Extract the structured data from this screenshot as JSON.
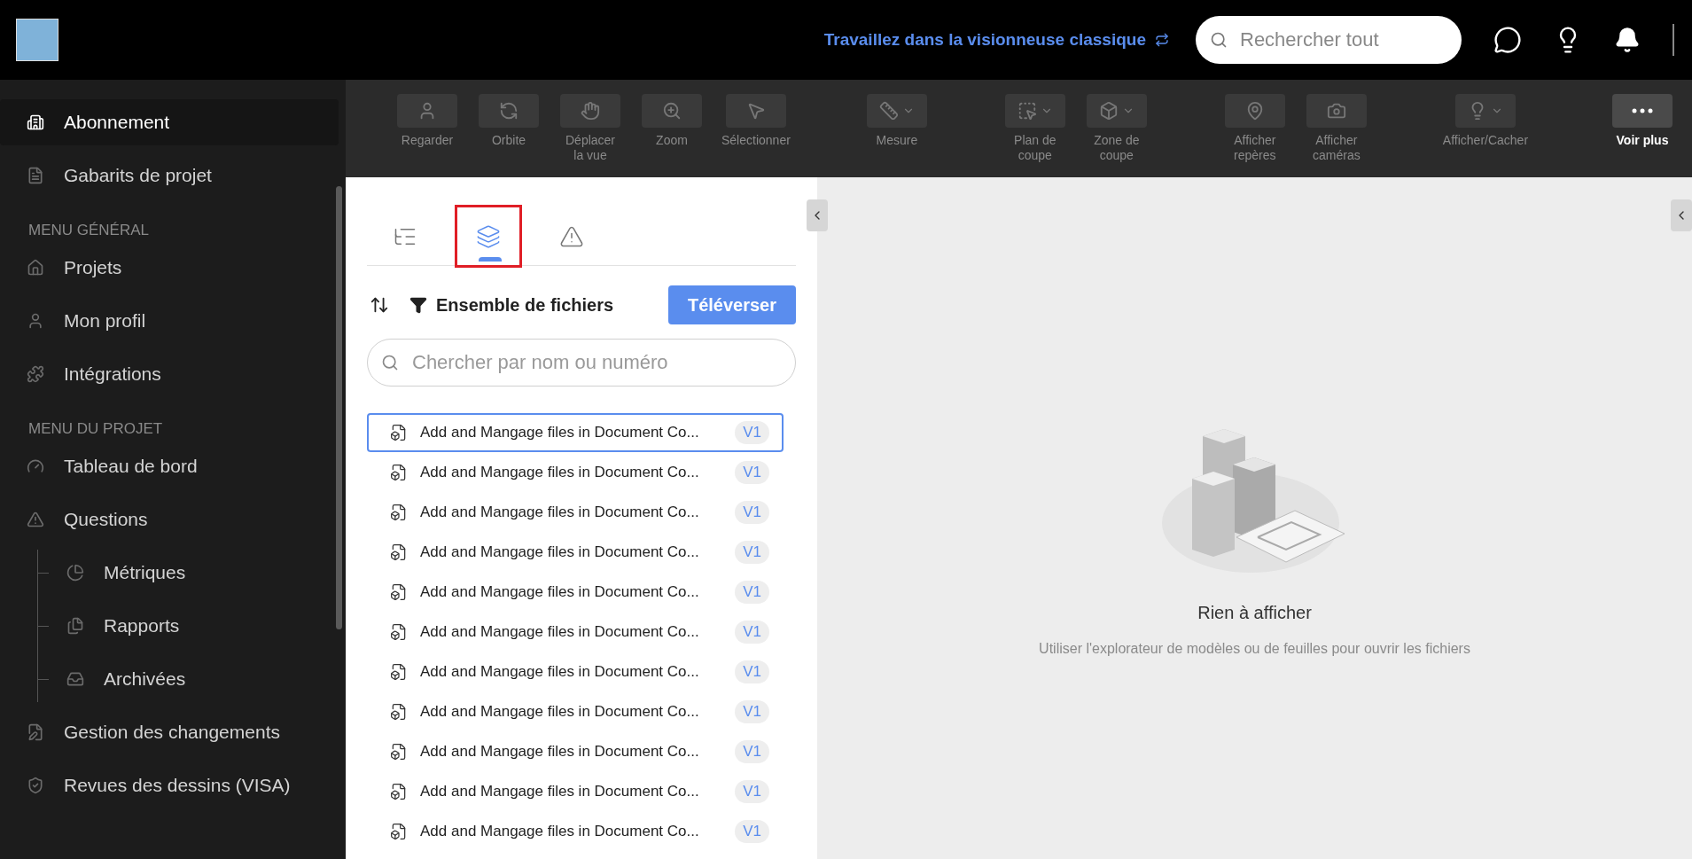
{
  "header": {
    "classic_link": "Travaillez dans la visionneuse classique",
    "search": {
      "placeholder": "Rechercher tout"
    }
  },
  "sidebar": {
    "sections": [
      {
        "items": [
          {
            "label": "Abonnement",
            "selected": true
          },
          {
            "label": "Gabarits de projet",
            "selected": false
          }
        ]
      },
      {
        "heading": "MENU GÉNÉRAL",
        "items": [
          {
            "label": "Projets",
            "selected": false
          },
          {
            "label": "Mon profil",
            "selected": false
          },
          {
            "label": "Intégrations",
            "selected": false
          }
        ]
      },
      {
        "heading": "MENU DU PROJET",
        "items": [
          {
            "label": "Tableau de bord",
            "selected": false
          },
          {
            "label": "Questions",
            "selected": false,
            "children": [
              {
                "label": "Métriques",
                "selected": false
              },
              {
                "label": "Rapports",
                "selected": false
              },
              {
                "label": "Archivées",
                "selected": false
              }
            ]
          },
          {
            "label": "Gestion des changements",
            "selected": false
          },
          {
            "label": "Revues des dessins (VISA)",
            "selected": false
          }
        ]
      }
    ]
  },
  "toolbar": {
    "groups": [
      [
        {
          "label": "Regarder",
          "kind": "button"
        },
        {
          "label": "Orbite",
          "kind": "button"
        },
        {
          "label": "Déplacer la vue",
          "kind": "button"
        },
        {
          "label": "Zoom",
          "kind": "button"
        },
        {
          "label": "Sélectionner",
          "kind": "button"
        }
      ],
      [
        {
          "label": "Mesure",
          "kind": "dropdown"
        }
      ],
      [
        {
          "label": "Plan de coupe",
          "kind": "dropdown"
        },
        {
          "label": "Zone de coupe",
          "kind": "dropdown"
        }
      ],
      [
        {
          "label": "Afficher repères",
          "kind": "button"
        },
        {
          "label": "Afficher caméras",
          "kind": "button"
        }
      ],
      [
        {
          "label": "Afficher/Cacher",
          "kind": "dropdown"
        }
      ],
      [
        {
          "label": "Voir plus",
          "kind": "more"
        }
      ]
    ]
  },
  "panel": {
    "tabs": [
      {
        "selected": false
      },
      {
        "selected": true
      },
      {
        "selected": false
      }
    ],
    "filter_label": "Ensemble de fichiers",
    "upload_button": "Téléverser",
    "search": {
      "placeholder": "Chercher par nom ou numéro"
    },
    "files": [
      {
        "name": "Add and Mangage files in Document Co...",
        "version": "V1",
        "selected": true
      },
      {
        "name": "Add and Mangage files in Document Co...",
        "version": "V1",
        "selected": false
      },
      {
        "name": "Add and Mangage files in Document Co...",
        "version": "V1",
        "selected": false
      },
      {
        "name": "Add and Mangage files in Document Co...",
        "version": "V1",
        "selected": false
      },
      {
        "name": "Add and Mangage files in Document Co...",
        "version": "V1",
        "selected": false
      },
      {
        "name": "Add and Mangage files in Document Co...",
        "version": "V1",
        "selected": false
      },
      {
        "name": "Add and Mangage files in Document Co...",
        "version": "V1",
        "selected": false
      },
      {
        "name": "Add and Mangage files in Document Co...",
        "version": "V1",
        "selected": false
      },
      {
        "name": "Add and Mangage files in Document Co...",
        "version": "V1",
        "selected": false
      },
      {
        "name": "Add and Mangage files in Document Co...",
        "version": "V1",
        "selected": false
      },
      {
        "name": "Add and Mangage files in Document Co...",
        "version": "V1",
        "selected": false
      }
    ]
  },
  "viewer": {
    "empty_title": "Rien à afficher",
    "empty_hint": "Utiliser l'explorateur de modèles ou de feuilles pour ouvrir les fichiers"
  }
}
